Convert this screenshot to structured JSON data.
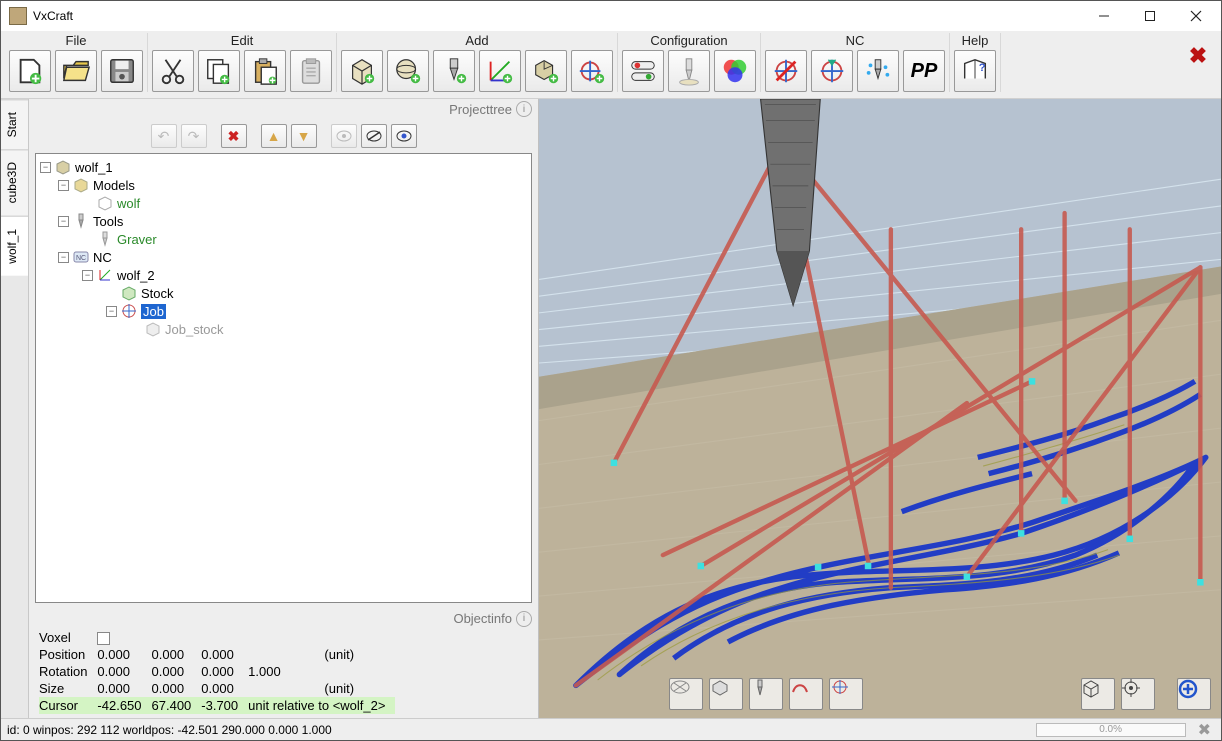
{
  "app": {
    "title": "VxCraft"
  },
  "toolbar": {
    "groups": {
      "file": "File",
      "edit": "Edit",
      "add": "Add",
      "configuration": "Configuration",
      "nc": "NC",
      "help": "Help"
    },
    "pp_label": "PP"
  },
  "vtabs": [
    {
      "label": "Start"
    },
    {
      "label": "cube3D"
    },
    {
      "label": "wolf_1"
    }
  ],
  "projecttree": {
    "panel_label": "Projecttree",
    "root": "wolf_1",
    "models_label": "Models",
    "model_item": "wolf",
    "tools_label": "Tools",
    "tool_item": "Graver",
    "nc_label": "NC",
    "nc_item": "wolf_2",
    "stock_label": "Stock",
    "job_label": "Job",
    "job_stock_label": "Job_stock"
  },
  "objectinfo": {
    "panel_label": "Objectinfo",
    "voxel_label": "Voxel",
    "position_label": "Position",
    "rotation_label": "Rotation",
    "size_label": "Size",
    "cursor_label": "Cursor",
    "unit_label": "(unit)",
    "position": [
      "0.000",
      "0.000",
      "0.000"
    ],
    "rotation": [
      "0.000",
      "0.000",
      "0.000",
      "1.000"
    ],
    "size": [
      "0.000",
      "0.000",
      "0.000"
    ],
    "cursor": [
      "-42.650",
      "67.400",
      "-3.700"
    ],
    "cursor_note": "unit relative to <wolf_2>"
  },
  "status": {
    "text": "id: 0 winpos: 292 112 worldpos: -42.501 290.000 0.000 1.000",
    "progress": "0.0%"
  }
}
